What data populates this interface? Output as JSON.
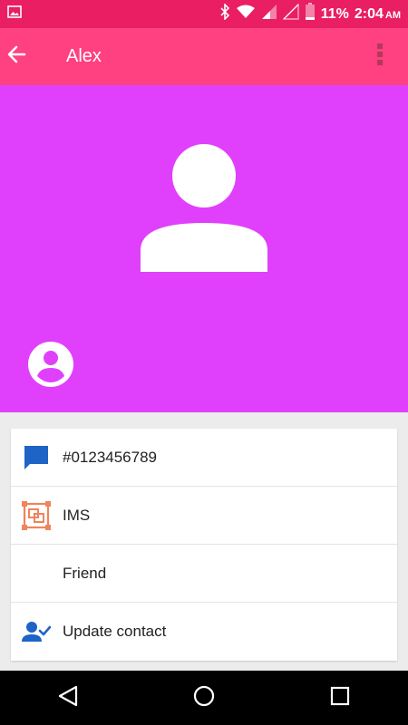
{
  "status_bar": {
    "battery_percent": "11%",
    "time": "2:04",
    "ampm": "AM",
    "icons": [
      "image-icon",
      "bluetooth-icon",
      "wifi-icon",
      "signal-icon",
      "signal-empty-icon",
      "battery-icon"
    ]
  },
  "app_bar": {
    "title": "Alex",
    "back_icon": "arrow-back-icon",
    "more_icon": "more-vert-icon"
  },
  "hero": {
    "background_color": "#e040fb",
    "avatar_icon": "person-icon",
    "small_icon": "account-circle-icon"
  },
  "contact_rows": [
    {
      "icon": "message-icon",
      "label": "#0123456789"
    },
    {
      "icon": "ims-icon",
      "label": "IMS"
    },
    {
      "icon": "",
      "label": "Friend"
    },
    {
      "icon": "update-contact-icon",
      "label": "Update contact"
    }
  ],
  "nav_bar": {
    "icons": [
      "back-triangle-icon",
      "home-circle-icon",
      "recents-square-icon"
    ]
  },
  "colors": {
    "status_bar": "#e91e63",
    "app_bar": "#ff4081",
    "accent_blue": "#1e63c6",
    "ims_orange": "#f0845a"
  }
}
